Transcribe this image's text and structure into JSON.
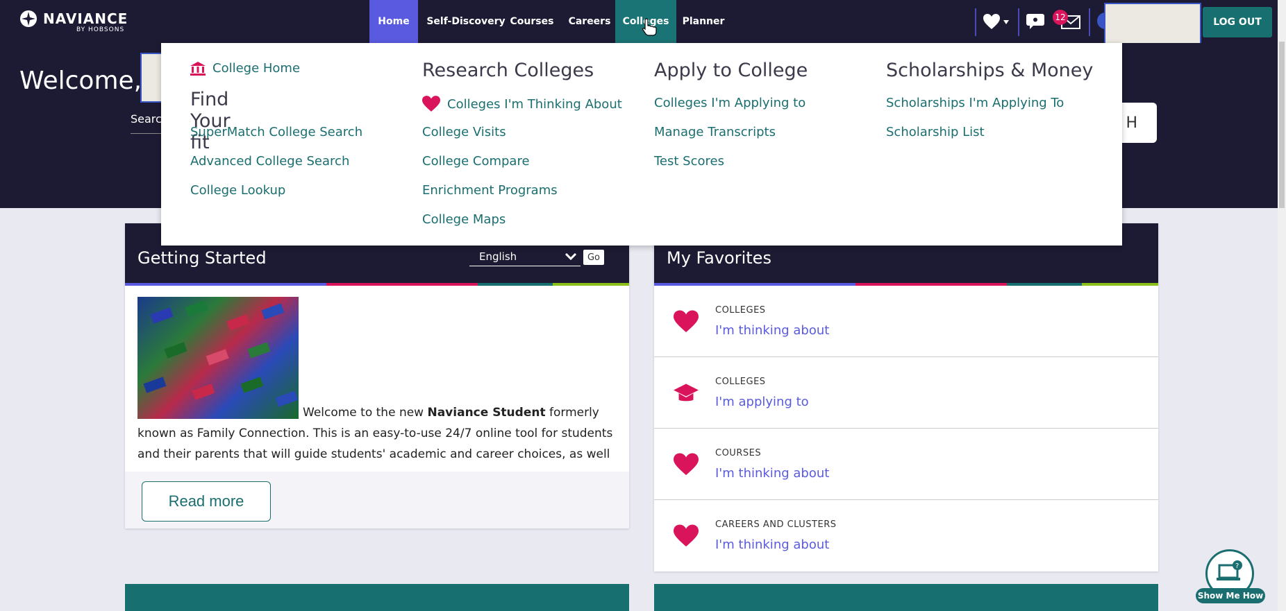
{
  "header": {
    "brand": "NAVIANCE",
    "brand_sub": "BY HOBSONS",
    "nav": [
      "Home",
      "Self-Discovery",
      "Courses",
      "Careers",
      "Colleges",
      "Planner"
    ],
    "message_count": "12",
    "logout_label": "LOG OUT"
  },
  "hero": {
    "welcome": "Welcome,",
    "search_label": "Searc",
    "search_button_tail": "H"
  },
  "mega_menu": {
    "col1": {
      "home_link": "College Home",
      "heading": "Find Your fit",
      "links": [
        "SuperMatch College Search",
        "Advanced College Search",
        "College Lookup"
      ]
    },
    "col2": {
      "heading": "Research Colleges",
      "links": [
        "Colleges I'm Thinking About",
        "College Visits",
        "College Compare",
        "Enrichment Programs",
        "College Maps"
      ]
    },
    "col3": {
      "heading": "Apply to College",
      "links": [
        "Colleges I'm Applying to",
        "Manage Transcripts",
        "Test Scores"
      ]
    },
    "col4": {
      "heading": "Scholarships & Money",
      "links": [
        "Scholarships I'm Applying To",
        "Scholarship List"
      ]
    }
  },
  "getting_started": {
    "title": "Getting Started",
    "language": "English",
    "go_label": "Go",
    "text_pre": "Welcome to the new ",
    "text_bold": "Naviance Student",
    "text_post": " formerly known as Family Connection. This is an easy-to-use 24/7 online tool for students and their parents that will guide students' academic and career choices, as well as",
    "read_more": "Read more"
  },
  "favorites": {
    "title": "My Favorites",
    "rows": [
      {
        "category": "COLLEGES",
        "link": "I'm thinking about"
      },
      {
        "category": "COLLEGES",
        "link": "I'm applying to"
      },
      {
        "category": "COURSES",
        "link": "I'm thinking about"
      },
      {
        "category": "CAREERS AND CLUSTERS",
        "link": "I'm thinking about"
      }
    ]
  },
  "show_me_how": "Show Me How",
  "colors": {
    "nav_dark": "#1c1b33",
    "home_tab": "#5a5ae0",
    "teal": "#17706f",
    "heart": "#d9145a"
  }
}
